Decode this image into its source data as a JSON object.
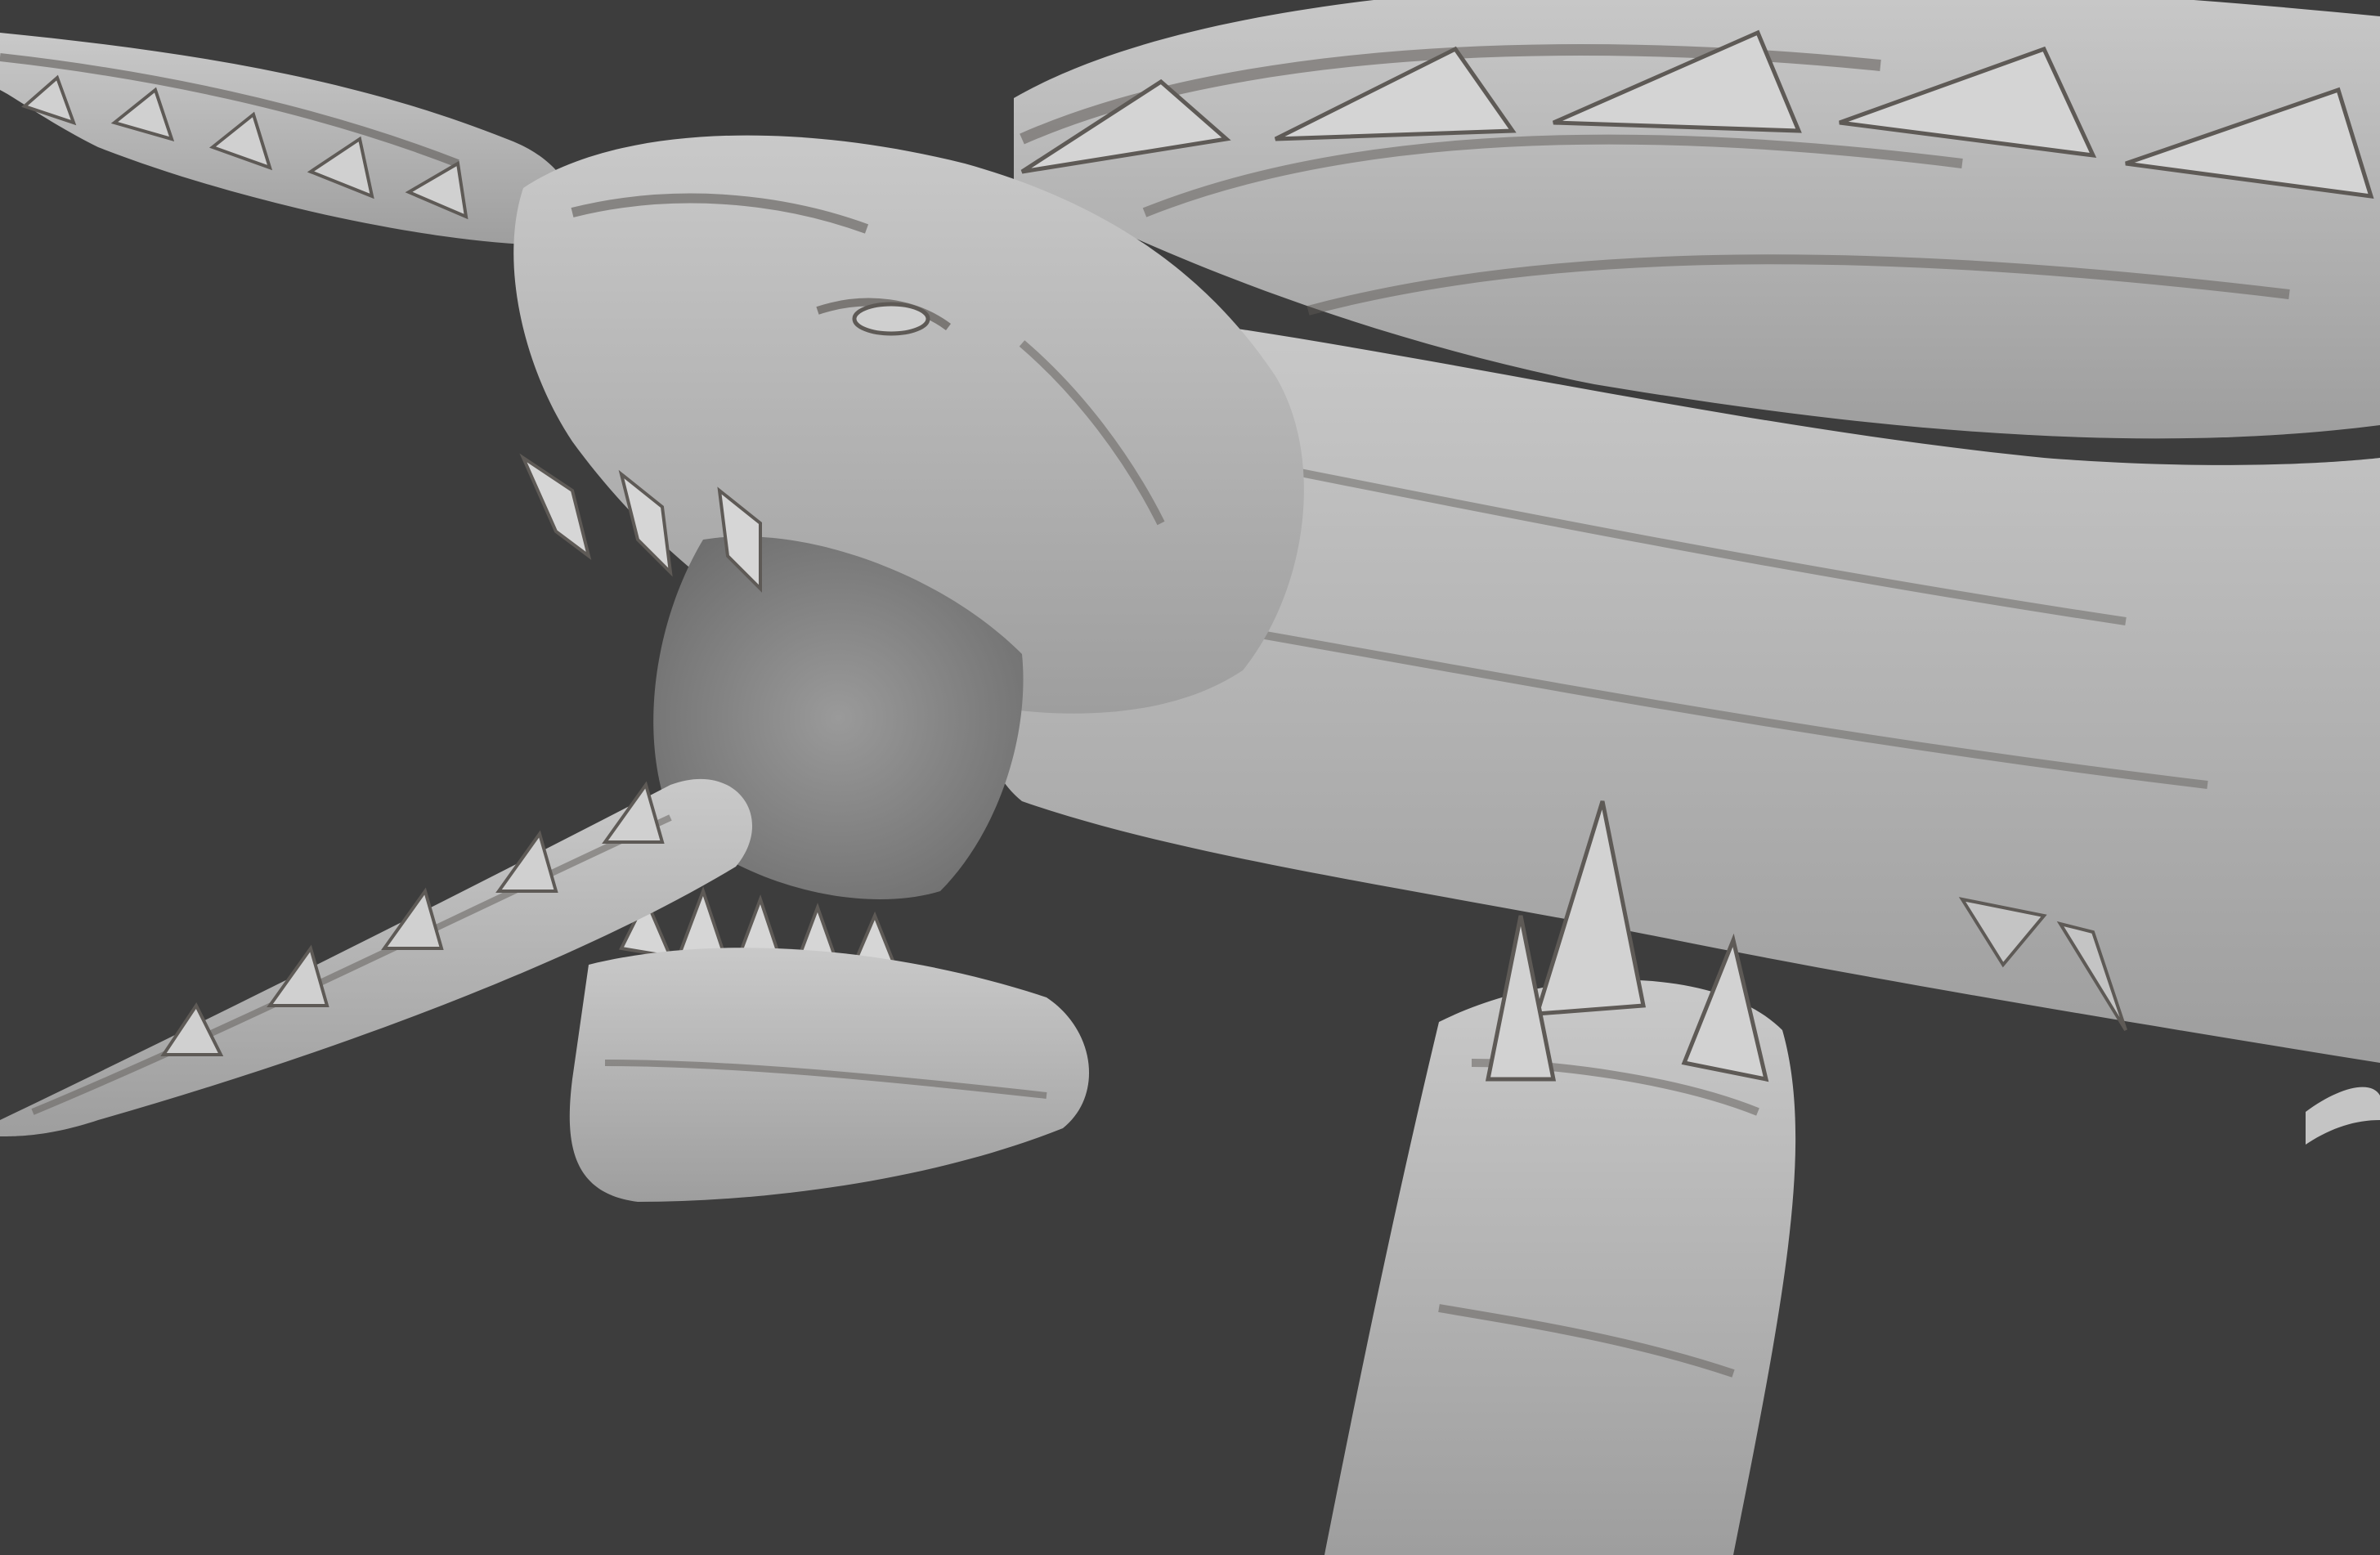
{
  "viewport": {
    "background_color": "#3d3d3d",
    "mesh_color": "#b8b8b8",
    "mesh_shadow_color": "#5e5a56",
    "mesh_highlight_color": "#d2d2d2"
  },
  "model": {
    "subject": "dragon-sculpt",
    "shading": "matcap-clay"
  }
}
